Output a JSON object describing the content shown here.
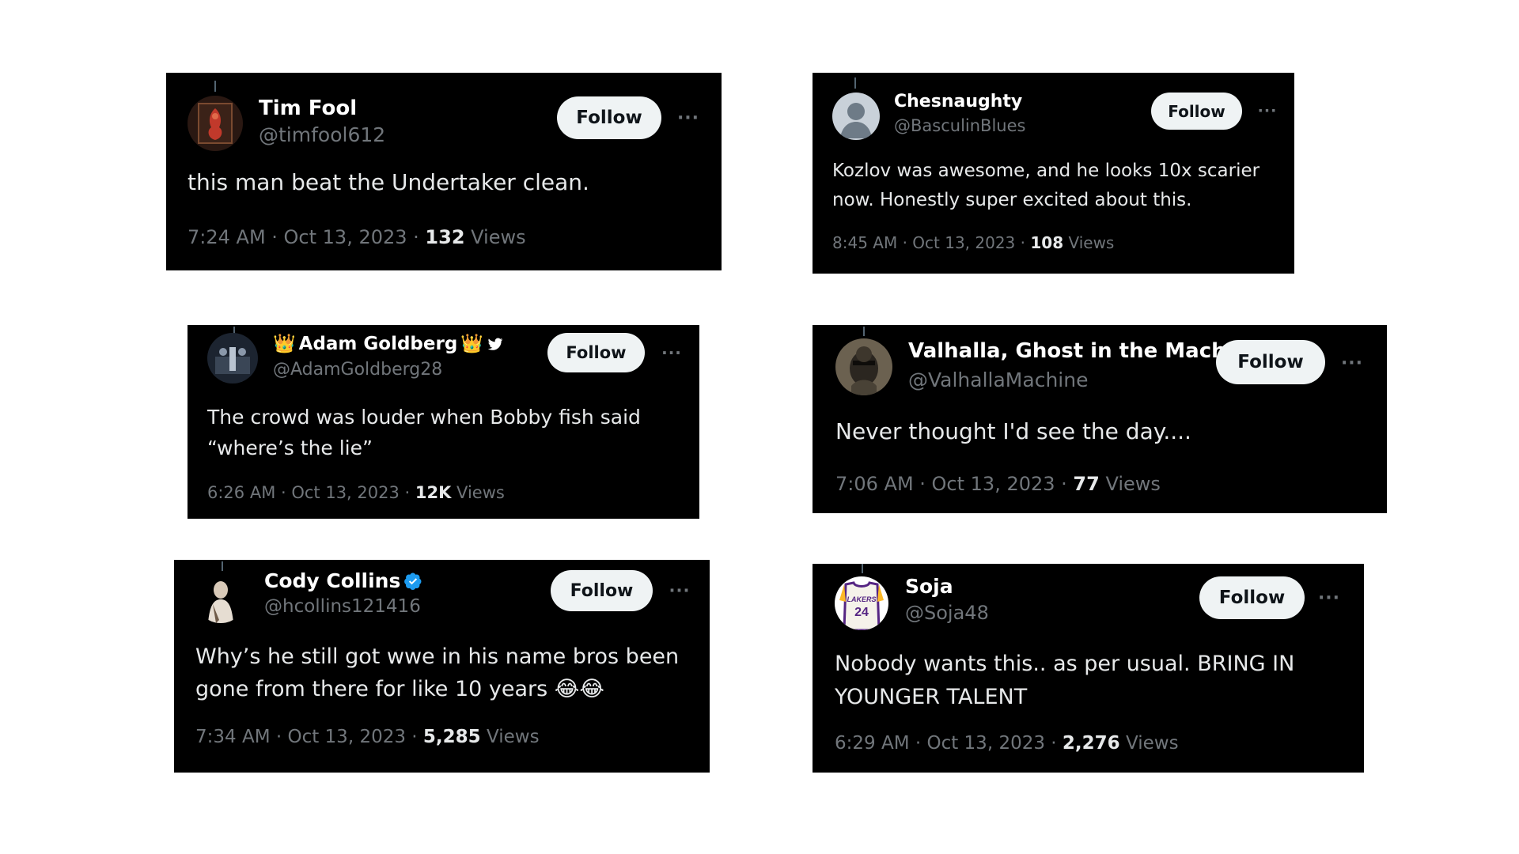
{
  "tweets": [
    {
      "name": "Tim Fool",
      "handle": "@timfool612",
      "follow_label": "Follow",
      "more_label": "···",
      "text": "this man beat the Undertaker clean.",
      "time": "7:24 AM · Oct 13, 2023 · ",
      "views_count": "132",
      "views_label": " Views"
    },
    {
      "name": "Chesnaughty",
      "handle": "@BasculinBlues",
      "follow_label": "Follow",
      "more_label": "···",
      "text": "Kozlov was awesome, and he looks 10x scarier now. Honestly super excited about this.",
      "time": "8:45 AM · Oct 13, 2023 · ",
      "views_count": "108",
      "views_label": " Views"
    },
    {
      "name": "Adam Goldberg",
      "crown_left": "👑",
      "crown_right": "👑",
      "handle": "@AdamGoldberg28",
      "follow_label": "Follow",
      "more_label": "···",
      "text": "The crowd was louder when Bobby fish said “where’s the lie”",
      "time": "6:26 AM · Oct 13, 2023 · ",
      "views_count": "12K",
      "views_label": " Views"
    },
    {
      "name": "Valhalla, Ghost in the Mach...",
      "handle": "@ValhallaMachine",
      "follow_label": "Follow",
      "more_label": "···",
      "text": "Never thought I'd see the day....",
      "time": "7:06 AM · Oct 13, 2023 · ",
      "views_count": "77",
      "views_label": " Views"
    },
    {
      "name": "Cody Collins",
      "handle": "@hcollins121416",
      "follow_label": "Follow",
      "more_label": "···",
      "text": "Why’s he still got wwe in his name bros been gone from there for like 10 years 😂😂",
      "time": "7:34 AM · Oct 13, 2023 · ",
      "views_count": "5,285",
      "views_label": " Views"
    },
    {
      "name": "Soja",
      "handle": "@Soja48",
      "follow_label": "Follow",
      "more_label": "···",
      "text": "Nobody wants this.. as per usual. BRING IN YOUNGER TALENT",
      "time": "6:29 AM · Oct 13, 2023 · ",
      "views_count": "2,276",
      "views_label": " Views",
      "jersey_team": "LAKERS",
      "jersey_number": "24"
    }
  ],
  "colors": {
    "background": "#ffffff",
    "card": "#000000",
    "primary_text": "#e7e9ea",
    "secondary_text": "#71767b",
    "follow_bg": "#eff3f4",
    "verified": "#1d9bf0"
  }
}
